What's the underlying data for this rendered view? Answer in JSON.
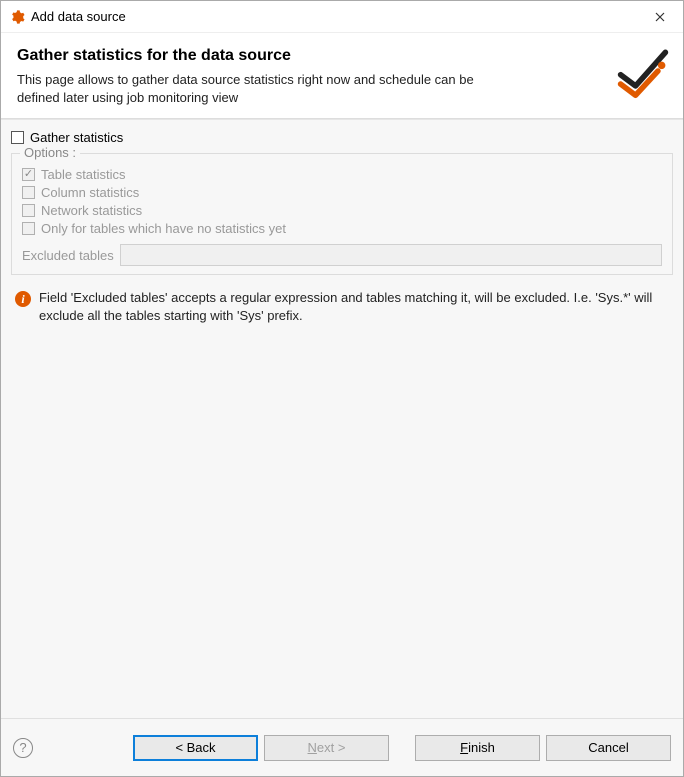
{
  "window": {
    "title": "Add data source"
  },
  "header": {
    "heading": "Gather statistics for the data source",
    "description": "This page allows to gather data source statistics right now and schedule can be defined later using job monitoring view"
  },
  "gather": {
    "label": "Gather statistics",
    "checked": false
  },
  "options": {
    "legend": "Options :",
    "table_statistics": {
      "label": "Table statistics",
      "checked": true,
      "enabled": false
    },
    "column_statistics": {
      "label": "Column statistics",
      "checked": false,
      "enabled": false
    },
    "network_statistics": {
      "label": "Network statistics",
      "checked": false,
      "enabled": false
    },
    "only_no_stats": {
      "label": "Only for tables which have no statistics yet",
      "checked": false,
      "enabled": false
    },
    "excluded_tables": {
      "label": "Excluded tables",
      "value": "",
      "enabled": false
    }
  },
  "info": {
    "text": "Field 'Excluded tables' accepts a regular expression and tables matching it, will be excluded. I.e. 'Sys.*' will exclude all the tables starting with 'Sys' prefix."
  },
  "buttons": {
    "back": "< Back",
    "next_prefix": "N",
    "next_suffix": "ext >",
    "finish_prefix": "F",
    "finish_suffix": "inish",
    "cancel": "Cancel"
  }
}
